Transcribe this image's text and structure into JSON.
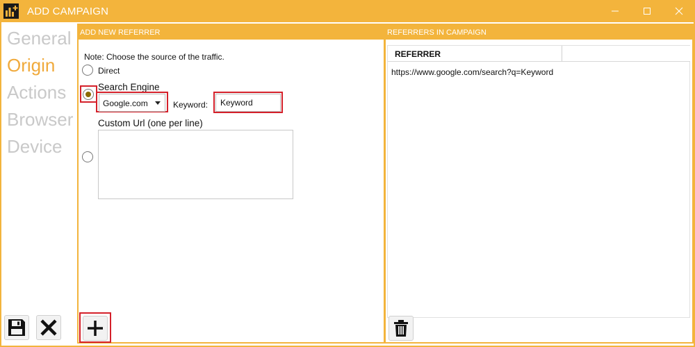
{
  "window": {
    "title": "ADD CAMPAIGN",
    "icon": "app-logo-icon",
    "controls": {
      "minimize": "minimize-icon",
      "maximize": "maximize-icon",
      "close": "close-icon"
    }
  },
  "nav": {
    "items": [
      {
        "label": "General",
        "active": false
      },
      {
        "label": "Origin",
        "active": true
      },
      {
        "label": "Actions",
        "active": false
      },
      {
        "label": "Browser",
        "active": false
      },
      {
        "label": "Device",
        "active": false
      }
    ]
  },
  "add_referrer": {
    "header": "ADD NEW REFERRER",
    "note": "Note: Choose the source of the traffic.",
    "options": {
      "direct": {
        "label": "Direct",
        "checked": false
      },
      "search_engine": {
        "label": "Search Engine",
        "checked": true
      },
      "custom_url": {
        "label": "Custom Url (one per line)",
        "checked": false
      }
    },
    "engine_select": {
      "value": "Google.com"
    },
    "keyword": {
      "label": "Keyword:",
      "value": "Keyword"
    },
    "custom_urls": {
      "value": ""
    },
    "add_button_icon": "plus-icon"
  },
  "referrers": {
    "header": "REFERRERS IN CAMPAIGN",
    "columns": [
      "REFERRER",
      ""
    ],
    "rows": [
      "https://www.google.com/search?q=Keyword"
    ],
    "delete_button_icon": "trash-icon"
  },
  "footer": {
    "save_icon": "save-icon",
    "cancel_icon": "close-x-icon"
  },
  "colors": {
    "accent": "#f3b43c",
    "active_nav": "#f0aa3c",
    "inactive_nav": "#c9c9c9",
    "highlight": "#d4202a"
  }
}
